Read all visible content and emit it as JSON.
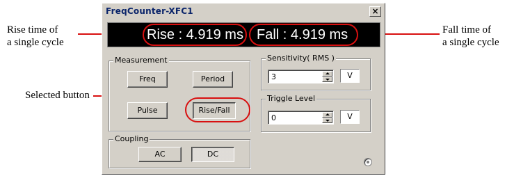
{
  "window": {
    "title": "FreqCounter-XFC1",
    "close_label": "×"
  },
  "display": {
    "rise": "Rise : 4.919 ms",
    "fall": "Fall : 4.919 ms"
  },
  "measurement": {
    "label": "Measurement",
    "buttons": [
      "Freq",
      "Period",
      "Pulse",
      "Rise/Fall"
    ],
    "selected": "Rise/Fall"
  },
  "coupling": {
    "label": "Coupling",
    "buttons": [
      "AC",
      "DC"
    ],
    "selected": "DC"
  },
  "sensitivity": {
    "label": "Sensitivity( RMS )",
    "value": "3",
    "unit": "V"
  },
  "trigger": {
    "label": "Triggle Level",
    "value": "0",
    "unit": "V"
  },
  "annotations": {
    "rise_line1": "Rise time of",
    "rise_line2": "a single cycle",
    "fall_line1": "Fall time of",
    "fall_line2": "a single cycle",
    "selected_button": "Selected button"
  },
  "colors": {
    "highlight": "#d81010",
    "window_face": "#d4d0c8",
    "display_bg": "#000000",
    "title_text": "#0a246a"
  }
}
